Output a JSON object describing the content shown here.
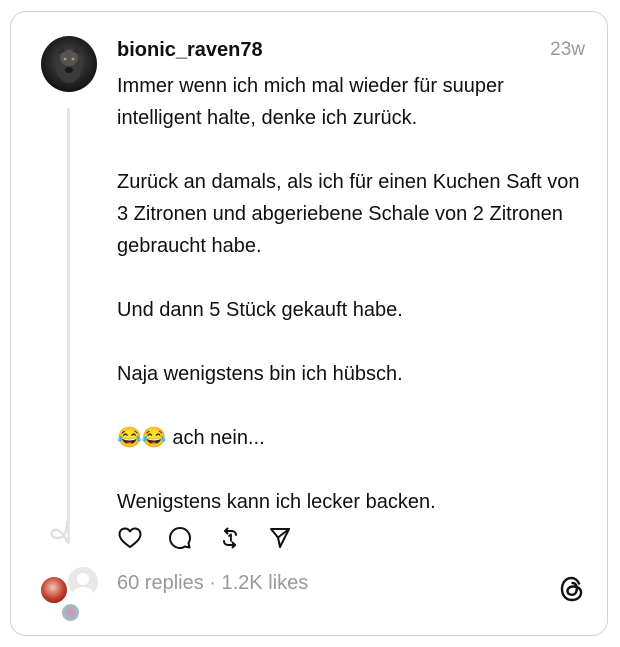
{
  "post": {
    "username": "bionic_raven78",
    "timestamp": "23w",
    "paragraphs": [
      "Immer wenn ich mich mal wieder für suuper intelligent halte, denke ich zurück.",
      "Zurück an damals, als ich für einen Kuchen Saft von 3 Zitronen und abgeriebene Schale von 2 Zitronen gebraucht habe.",
      "Und dann 5 Stück gekauft habe.",
      "Naja wenigstens bin ich hübsch.",
      "😂😂 ach nein...",
      "Wenigstens kann ich lecker backen."
    ],
    "stats": "60 replies · 1.2K likes"
  },
  "actions": {
    "like_icon": "heart-icon",
    "comment_icon": "comment-icon",
    "repost_icon": "repost-icon",
    "share_icon": "send-icon"
  },
  "brand": {
    "logo_icon": "threads-logo-icon"
  }
}
